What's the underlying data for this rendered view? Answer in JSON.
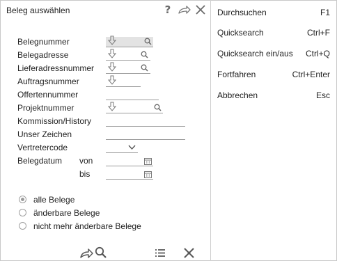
{
  "dialog": {
    "title": "Beleg auswählen",
    "toolbar": {
      "help_icon": "question-icon",
      "forward_icon": "forward-arrow-icon",
      "close_icon": "close-icon"
    }
  },
  "form": {
    "fields": [
      {
        "label": "Belegnummer",
        "value": "",
        "icons": [
          "arrow-down-icon",
          "search-icon"
        ]
      },
      {
        "label": "Belegadresse",
        "value": "",
        "icons": [
          "arrow-down-icon",
          "search-icon"
        ]
      },
      {
        "label": "Lieferadressnummer",
        "value": "",
        "icons": [
          "arrow-down-icon",
          "search-icon"
        ]
      },
      {
        "label": "Auftragsnummer",
        "value": "",
        "icons": [
          "arrow-down-icon"
        ]
      },
      {
        "label": "Offertennummer",
        "value": "",
        "icons": []
      },
      {
        "label": "Projektnummer",
        "value": "",
        "icons": [
          "arrow-down-icon",
          "search-icon"
        ]
      },
      {
        "label": "Kommission/History",
        "value": "",
        "icons": []
      },
      {
        "label": "Unser Zeichen",
        "value": "",
        "icons": []
      },
      {
        "label": "Vertretercode",
        "value": "",
        "icons": [
          "chevron-down-icon"
        ]
      },
      {
        "label": "Belegdatum",
        "value": "",
        "icons": []
      }
    ],
    "date_from_label": "von",
    "date_to_label": "bis",
    "date_from_value": "",
    "date_to_value": ""
  },
  "filter": {
    "options": [
      "alle Belege",
      "änderbare Belege",
      "nicht mehr änderbare Belege"
    ],
    "selected": "alle Belege"
  },
  "bottom_toolbar": [
    "forward-search-icon",
    "list-icon",
    "close-icon"
  ],
  "menu": [
    {
      "label": "Durchsuchen",
      "shortcut": "F1"
    },
    {
      "label": "Quicksearch",
      "shortcut": "Ctrl+F"
    },
    {
      "label": "Quicksearch ein/aus",
      "shortcut": "Ctrl+Q"
    },
    {
      "label": "Fortfahren",
      "shortcut": "Ctrl+Enter"
    },
    {
      "label": "Abbrechen",
      "shortcut": "Esc"
    }
  ],
  "colors": {
    "icon": "#6b6b6b",
    "border": "#c8c8c8",
    "shaded_field": "#e3e3e3",
    "radio_dot": "#9a9a9a"
  }
}
